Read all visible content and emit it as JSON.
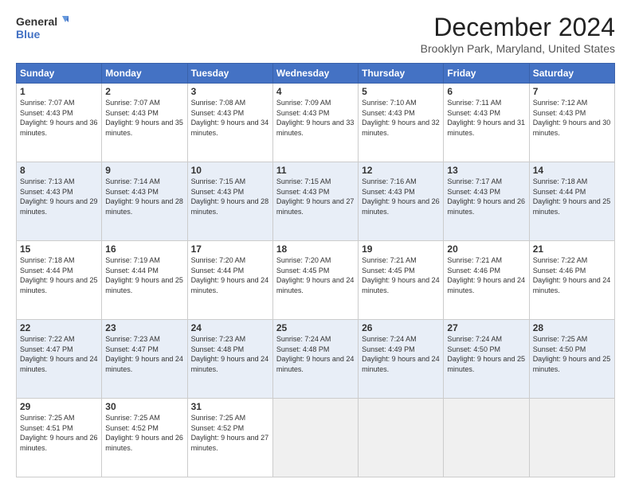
{
  "header": {
    "logo_line1": "General",
    "logo_line2": "Blue",
    "title": "December 2024",
    "subtitle": "Brooklyn Park, Maryland, United States"
  },
  "days_of_week": [
    "Sunday",
    "Monday",
    "Tuesday",
    "Wednesday",
    "Thursday",
    "Friday",
    "Saturday"
  ],
  "weeks": [
    [
      {
        "num": "1",
        "sunrise": "Sunrise: 7:07 AM",
        "sunset": "Sunset: 4:43 PM",
        "daylight": "Daylight: 9 hours and 36 minutes."
      },
      {
        "num": "2",
        "sunrise": "Sunrise: 7:07 AM",
        "sunset": "Sunset: 4:43 PM",
        "daylight": "Daylight: 9 hours and 35 minutes."
      },
      {
        "num": "3",
        "sunrise": "Sunrise: 7:08 AM",
        "sunset": "Sunset: 4:43 PM",
        "daylight": "Daylight: 9 hours and 34 minutes."
      },
      {
        "num": "4",
        "sunrise": "Sunrise: 7:09 AM",
        "sunset": "Sunset: 4:43 PM",
        "daylight": "Daylight: 9 hours and 33 minutes."
      },
      {
        "num": "5",
        "sunrise": "Sunrise: 7:10 AM",
        "sunset": "Sunset: 4:43 PM",
        "daylight": "Daylight: 9 hours and 32 minutes."
      },
      {
        "num": "6",
        "sunrise": "Sunrise: 7:11 AM",
        "sunset": "Sunset: 4:43 PM",
        "daylight": "Daylight: 9 hours and 31 minutes."
      },
      {
        "num": "7",
        "sunrise": "Sunrise: 7:12 AM",
        "sunset": "Sunset: 4:43 PM",
        "daylight": "Daylight: 9 hours and 30 minutes."
      }
    ],
    [
      {
        "num": "8",
        "sunrise": "Sunrise: 7:13 AM",
        "sunset": "Sunset: 4:43 PM",
        "daylight": "Daylight: 9 hours and 29 minutes."
      },
      {
        "num": "9",
        "sunrise": "Sunrise: 7:14 AM",
        "sunset": "Sunset: 4:43 PM",
        "daylight": "Daylight: 9 hours and 28 minutes."
      },
      {
        "num": "10",
        "sunrise": "Sunrise: 7:15 AM",
        "sunset": "Sunset: 4:43 PM",
        "daylight": "Daylight: 9 hours and 28 minutes."
      },
      {
        "num": "11",
        "sunrise": "Sunrise: 7:15 AM",
        "sunset": "Sunset: 4:43 PM",
        "daylight": "Daylight: 9 hours and 27 minutes."
      },
      {
        "num": "12",
        "sunrise": "Sunrise: 7:16 AM",
        "sunset": "Sunset: 4:43 PM",
        "daylight": "Daylight: 9 hours and 26 minutes."
      },
      {
        "num": "13",
        "sunrise": "Sunrise: 7:17 AM",
        "sunset": "Sunset: 4:43 PM",
        "daylight": "Daylight: 9 hours and 26 minutes."
      },
      {
        "num": "14",
        "sunrise": "Sunrise: 7:18 AM",
        "sunset": "Sunset: 4:44 PM",
        "daylight": "Daylight: 9 hours and 25 minutes."
      }
    ],
    [
      {
        "num": "15",
        "sunrise": "Sunrise: 7:18 AM",
        "sunset": "Sunset: 4:44 PM",
        "daylight": "Daylight: 9 hours and 25 minutes."
      },
      {
        "num": "16",
        "sunrise": "Sunrise: 7:19 AM",
        "sunset": "Sunset: 4:44 PM",
        "daylight": "Daylight: 9 hours and 25 minutes."
      },
      {
        "num": "17",
        "sunrise": "Sunrise: 7:20 AM",
        "sunset": "Sunset: 4:44 PM",
        "daylight": "Daylight: 9 hours and 24 minutes."
      },
      {
        "num": "18",
        "sunrise": "Sunrise: 7:20 AM",
        "sunset": "Sunset: 4:45 PM",
        "daylight": "Daylight: 9 hours and 24 minutes."
      },
      {
        "num": "19",
        "sunrise": "Sunrise: 7:21 AM",
        "sunset": "Sunset: 4:45 PM",
        "daylight": "Daylight: 9 hours and 24 minutes."
      },
      {
        "num": "20",
        "sunrise": "Sunrise: 7:21 AM",
        "sunset": "Sunset: 4:46 PM",
        "daylight": "Daylight: 9 hours and 24 minutes."
      },
      {
        "num": "21",
        "sunrise": "Sunrise: 7:22 AM",
        "sunset": "Sunset: 4:46 PM",
        "daylight": "Daylight: 9 hours and 24 minutes."
      }
    ],
    [
      {
        "num": "22",
        "sunrise": "Sunrise: 7:22 AM",
        "sunset": "Sunset: 4:47 PM",
        "daylight": "Daylight: 9 hours and 24 minutes."
      },
      {
        "num": "23",
        "sunrise": "Sunrise: 7:23 AM",
        "sunset": "Sunset: 4:47 PM",
        "daylight": "Daylight: 9 hours and 24 minutes."
      },
      {
        "num": "24",
        "sunrise": "Sunrise: 7:23 AM",
        "sunset": "Sunset: 4:48 PM",
        "daylight": "Daylight: 9 hours and 24 minutes."
      },
      {
        "num": "25",
        "sunrise": "Sunrise: 7:24 AM",
        "sunset": "Sunset: 4:48 PM",
        "daylight": "Daylight: 9 hours and 24 minutes."
      },
      {
        "num": "26",
        "sunrise": "Sunrise: 7:24 AM",
        "sunset": "Sunset: 4:49 PM",
        "daylight": "Daylight: 9 hours and 24 minutes."
      },
      {
        "num": "27",
        "sunrise": "Sunrise: 7:24 AM",
        "sunset": "Sunset: 4:50 PM",
        "daylight": "Daylight: 9 hours and 25 minutes."
      },
      {
        "num": "28",
        "sunrise": "Sunrise: 7:25 AM",
        "sunset": "Sunset: 4:50 PM",
        "daylight": "Daylight: 9 hours and 25 minutes."
      }
    ],
    [
      {
        "num": "29",
        "sunrise": "Sunrise: 7:25 AM",
        "sunset": "Sunset: 4:51 PM",
        "daylight": "Daylight: 9 hours and 26 minutes."
      },
      {
        "num": "30",
        "sunrise": "Sunrise: 7:25 AM",
        "sunset": "Sunset: 4:52 PM",
        "daylight": "Daylight: 9 hours and 26 minutes."
      },
      {
        "num": "31",
        "sunrise": "Sunrise: 7:25 AM",
        "sunset": "Sunset: 4:52 PM",
        "daylight": "Daylight: 9 hours and 27 minutes."
      },
      null,
      null,
      null,
      null
    ]
  ]
}
